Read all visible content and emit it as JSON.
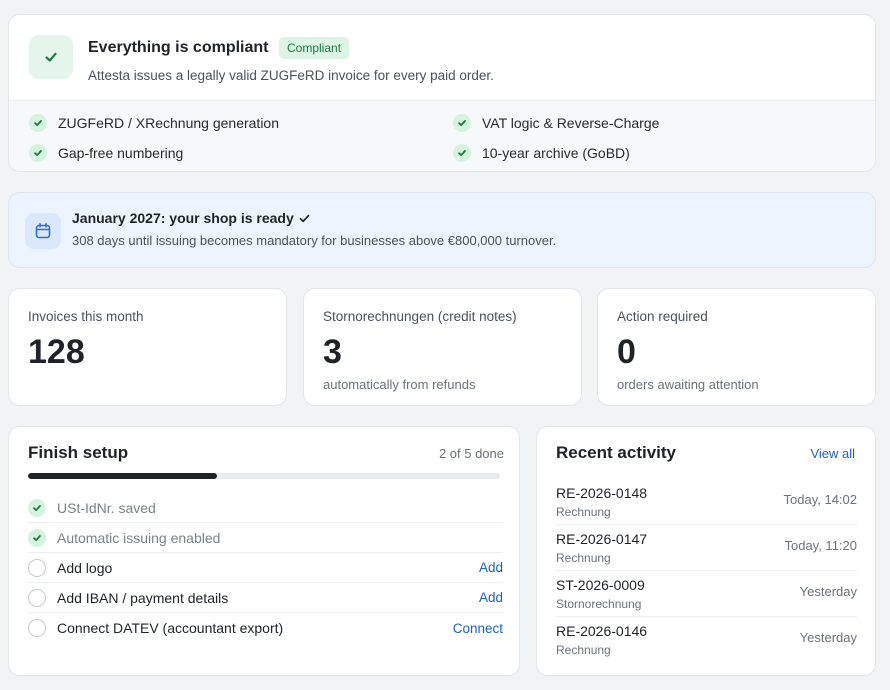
{
  "compliance": {
    "title": "Everything is compliant",
    "badge": "Compliant",
    "subtitle": "Attesta issues a legally valid ZUGFeRD invoice for every paid order.",
    "features": [
      "ZUGFeRD / XRechnung generation",
      "VAT logic & Reverse-Charge",
      "Gap-free numbering",
      "10-year archive (GoBD)"
    ],
    "icon": "check-icon"
  },
  "deadline": {
    "title": "January 2027: your shop is ready",
    "subtitle": "308 days until issuing becomes mandatory for businesses above €800,000 turnover.",
    "icon": "calendar-icon"
  },
  "stats": [
    {
      "label": "Invoices this month",
      "value": "128",
      "note": ""
    },
    {
      "label": "Stornorechnungen (credit notes)",
      "value": "3",
      "note": "automatically from refunds"
    },
    {
      "label": "Action required",
      "value": "0",
      "note": "orders awaiting attention"
    }
  ],
  "setup": {
    "title": "Finish setup",
    "count": "2 of 5 done",
    "progress_fraction": 0.4,
    "steps": [
      {
        "label": "USt-IdNr. saved",
        "done": true,
        "action": ""
      },
      {
        "label": "Automatic issuing enabled",
        "done": true,
        "action": ""
      },
      {
        "label": "Add logo",
        "done": false,
        "action": "Add"
      },
      {
        "label": "Add IBAN / payment details",
        "done": false,
        "action": "Add"
      },
      {
        "label": "Connect DATEV (accountant export)",
        "done": false,
        "action": "Connect"
      }
    ]
  },
  "activity": {
    "title": "Recent activity",
    "view_all": "View all",
    "items": [
      {
        "id": "RE-2026-0148",
        "type": "Rechnung",
        "time": "Today, 14:02"
      },
      {
        "id": "RE-2026-0147",
        "type": "Rechnung",
        "time": "Today, 11:20"
      },
      {
        "id": "ST-2026-0009",
        "type": "Stornorechnung",
        "time": "Yesterday"
      },
      {
        "id": "RE-2026-0146",
        "type": "Rechnung",
        "time": "Yesterday"
      }
    ]
  },
  "colors": {
    "success": "#1d7a40",
    "success_bg": "#dcf5e4",
    "link": "#1a63c7",
    "info_bg": "#eef4fd"
  }
}
